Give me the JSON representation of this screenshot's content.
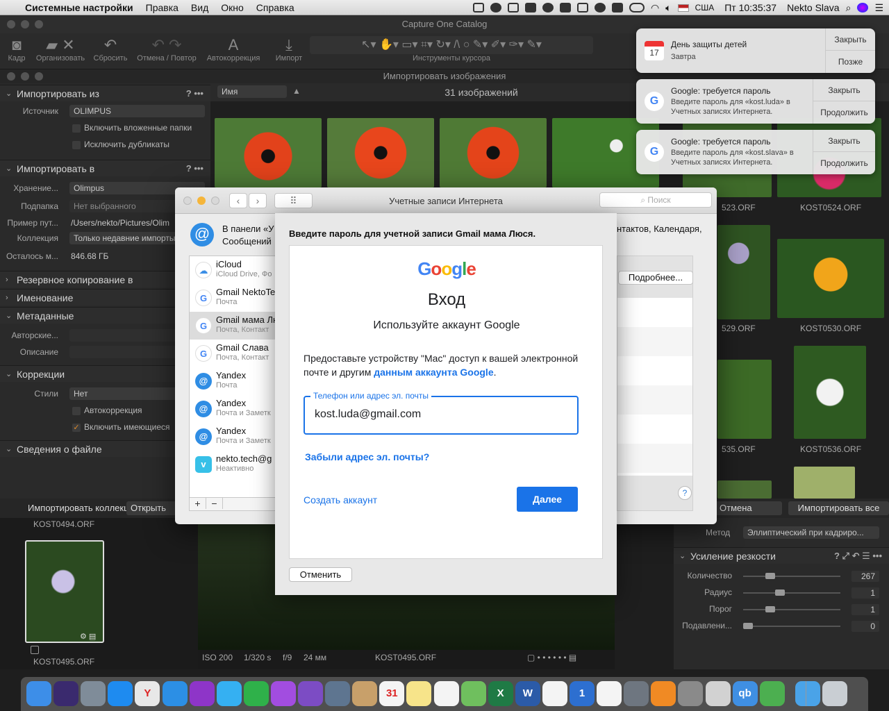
{
  "menubar": {
    "apple": "",
    "items": [
      "Системные настройки",
      "Правка",
      "Вид",
      "Окно",
      "Справка"
    ],
    "input_source": "США",
    "clock": "Пт 10:35:37",
    "user": "Nekto Slava"
  },
  "capture_one": {
    "title": "Capture One Catalog",
    "toolbar": [
      {
        "label": "Кадр",
        "icon": "camera-icon"
      },
      {
        "label": "Организовать",
        "icon": "folder-icon"
      },
      {
        "label": "Сбросить",
        "icon": "reset-icon"
      },
      {
        "label": "Отмена / Повтор",
        "icon": "undo-redo-icon"
      },
      {
        "label": "Автокоррекция",
        "icon": "auto-adjust-icon"
      },
      {
        "label": "Импорт",
        "icon": "import-icon"
      },
      {
        "label": "Инструменты курсора",
        "icon": "cursor-tools-icon"
      }
    ],
    "import_window_title": "Импортировать изображения",
    "import_from": {
      "header": "Импортировать из",
      "source_label": "Источник",
      "source_value": "OLIMPUS",
      "include_subfolders": "Включить вложенные папки",
      "exclude_duplicates": "Исключить дубликаты"
    },
    "import_to": {
      "header": "Импортировать в",
      "storage_label": "Хранение...",
      "storage_value": "Olimpus",
      "subfolder_label": "Подпапка",
      "subfolder_value": "Нет выбранного",
      "path_label": "Пример пут...",
      "path_value": "/Users/nekto/Pictures/Olim",
      "collection_label": "Коллекция",
      "collection_value": "Только недавние импорты",
      "space_label": "Осталось м...",
      "space_value": "846.68 ГБ"
    },
    "sections": [
      "Резервное копирование в",
      "Именование",
      "Метаданные",
      "Коррекции",
      "Сведения о файле"
    ],
    "metadata": {
      "author_label": "Авторские...",
      "description_label": "Описание"
    },
    "corrections": {
      "styles_label": "Стили",
      "styles_value": "Нет",
      "auto": "Автокоррекция",
      "include_existing": "Включить имеющиеся"
    },
    "options_glyph": "? •••",
    "sort_field": "Имя",
    "image_count": "31 изображений",
    "thumb_labels": [
      "523.ORF",
      "KOST0524.ORF",
      "529.ORF",
      "KOST0530.ORF",
      "535.ORF",
      "KOST0536.ORF"
    ],
    "bottom": {
      "import_collection": "Импортировать коллекцию",
      "open_collection": "Открыть ко",
      "cancel": "Отмена",
      "import_all": "Импортировать все"
    },
    "filmstrip": {
      "top_label": "KOST0494.ORF",
      "bottom_label": "KOST0495.ORF"
    },
    "info": {
      "iso": "ISO 200",
      "shutter": "1/320 s",
      "aperture": "f/9",
      "focal": "24 мм",
      "file": "KOST0495.ORF"
    },
    "right": {
      "method_label": "Метод",
      "method_value": "Эллиптический при кадриро...",
      "sharpen_header": "Усиление резкости",
      "rows": [
        {
          "label": "Количество",
          "value": "267",
          "level": 0.23
        },
        {
          "label": "Радиус",
          "value": "1",
          "level": 0.33
        },
        {
          "label": "Порог",
          "value": "1",
          "level": 0.23
        },
        {
          "label": "Подавлени...",
          "value": "0",
          "level": 0.0
        }
      ]
    }
  },
  "prefs": {
    "title": "Учетные записи Интернета",
    "search_placeholder": "Поиск",
    "intro_line1": "В панели «У",
    "intro_line2": "Сообщений",
    "intro_right": "нтактов, Календаря,",
    "details_button": "Подробнее...",
    "accounts": [
      {
        "name": "iCloud",
        "sub": "iCloud Drive, Фо",
        "type": "icloud"
      },
      {
        "name": "Gmail NektoTe",
        "sub": "Почта",
        "type": "google"
      },
      {
        "name": "Gmail мама Лю",
        "sub": "Почта, Контакт",
        "type": "google"
      },
      {
        "name": "Gmail Слава",
        "sub": "Почта, Контакт",
        "type": "google"
      },
      {
        "name": "Yandex",
        "sub": "Почта",
        "type": "at"
      },
      {
        "name": "Yandex",
        "sub": "Почта и Заметк",
        "type": "at"
      },
      {
        "name": "Yandex",
        "sub": "Почта и Заметк",
        "type": "at"
      },
      {
        "name": "nekto.tech@g",
        "sub": "Неактивно",
        "type": "vimeo"
      }
    ],
    "add": "+",
    "remove": "−",
    "help": "?"
  },
  "sheet": {
    "heading": "Введите пароль для учетной записи Gmail мама Люся.",
    "google_logo": [
      "G",
      "o",
      "o",
      "g",
      "l",
      "e"
    ],
    "google_colors": [
      "#4285F4",
      "#EA4335",
      "#FBBC05",
      "#4285F4",
      "#34A853",
      "#EA4335"
    ],
    "signin_title": "Вход",
    "signin_sub": "Используйте аккаунт Google",
    "consent_part1": "Предоставьте устройству \"Mac\" доступ к вашей электронной почте и другим ",
    "consent_link": "данным аккаунта Google",
    "consent_end": ".",
    "field_label": "Телефон или адрес эл. почты",
    "field_value": "kost.luda@gmail.com",
    "forgot": "Забыли адрес эл. почты?",
    "create": "Создать аккаунт",
    "next": "Далее",
    "cancel": "Отменить"
  },
  "notifications": [
    {
      "title": "День защиты детей",
      "sub": "Завтра",
      "btn1": "Закрыть",
      "btn2": "Позже",
      "icon": "calendar-icon",
      "day": "17"
    },
    {
      "title": "Google: требуется пароль",
      "sub": "Введите пароль для «kost.luda» в Учетных записях Интернета.",
      "btn1": "Закрыть",
      "btn2": "Продолжить",
      "icon": "google-icon"
    },
    {
      "title": "Google: требуется пароль",
      "sub": "Введите пароль для «kost.slava» в Учетных записях Интернета.",
      "btn1": "Закрыть",
      "btn2": "Продолжить",
      "icon": "google-icon"
    }
  ],
  "dock": [
    {
      "name": "finder",
      "color": "#3d8ee8"
    },
    {
      "name": "siri",
      "color": "#3a2a6e"
    },
    {
      "name": "launchpad",
      "color": "#7f8c99"
    },
    {
      "name": "app-store",
      "color": "#1e8bf0"
    },
    {
      "name": "yandex-browser",
      "color": "#e8e8e8"
    },
    {
      "name": "safari",
      "color": "#2c8fe5"
    },
    {
      "name": "podcasts",
      "color": "#8e35c8"
    },
    {
      "name": "messages",
      "color": "#35b0f2"
    },
    {
      "name": "facetime",
      "color": "#2fb14a"
    },
    {
      "name": "telegram-like",
      "color": "#a24de0"
    },
    {
      "name": "viber",
      "color": "#7c4cc4"
    },
    {
      "name": "image-capture",
      "color": "#5e7590"
    },
    {
      "name": "contacts",
      "color": "#c8a06a"
    },
    {
      "name": "calendar",
      "color": "#f4f4f4"
    },
    {
      "name": "notes",
      "color": "#f7e48a"
    },
    {
      "name": "reminders",
      "color": "#f4f4f4"
    },
    {
      "name": "maps",
      "color": "#6fbf5e"
    },
    {
      "name": "excel",
      "color": "#1f7a45"
    },
    {
      "name": "word",
      "color": "#2b5ba8"
    },
    {
      "name": "photos",
      "color": "#f4f4f4"
    },
    {
      "name": "capture-one",
      "color": "#2d6fd0"
    },
    {
      "name": "music",
      "color": "#f4f4f4"
    },
    {
      "name": "disk-utility",
      "color": "#6e7680"
    },
    {
      "name": "books",
      "color": "#f08a24"
    },
    {
      "name": "system-preferences",
      "color": "#8a8a8a"
    },
    {
      "name": "script-editor",
      "color": "#d2d2d2"
    },
    {
      "name": "qbittorrent",
      "color": "#3f8fe3"
    },
    {
      "name": "adguard",
      "color": "#4caf50"
    },
    {
      "name": "downloads",
      "color": "#4aa3e8"
    },
    {
      "name": "trash",
      "color": "#c9ced3"
    }
  ],
  "dock_glyphs": {
    "yandex-browser": "Y",
    "qbittorrent": "qb",
    "calendar": "31",
    "capture-one": "1",
    "excel": "X",
    "word": "W"
  }
}
